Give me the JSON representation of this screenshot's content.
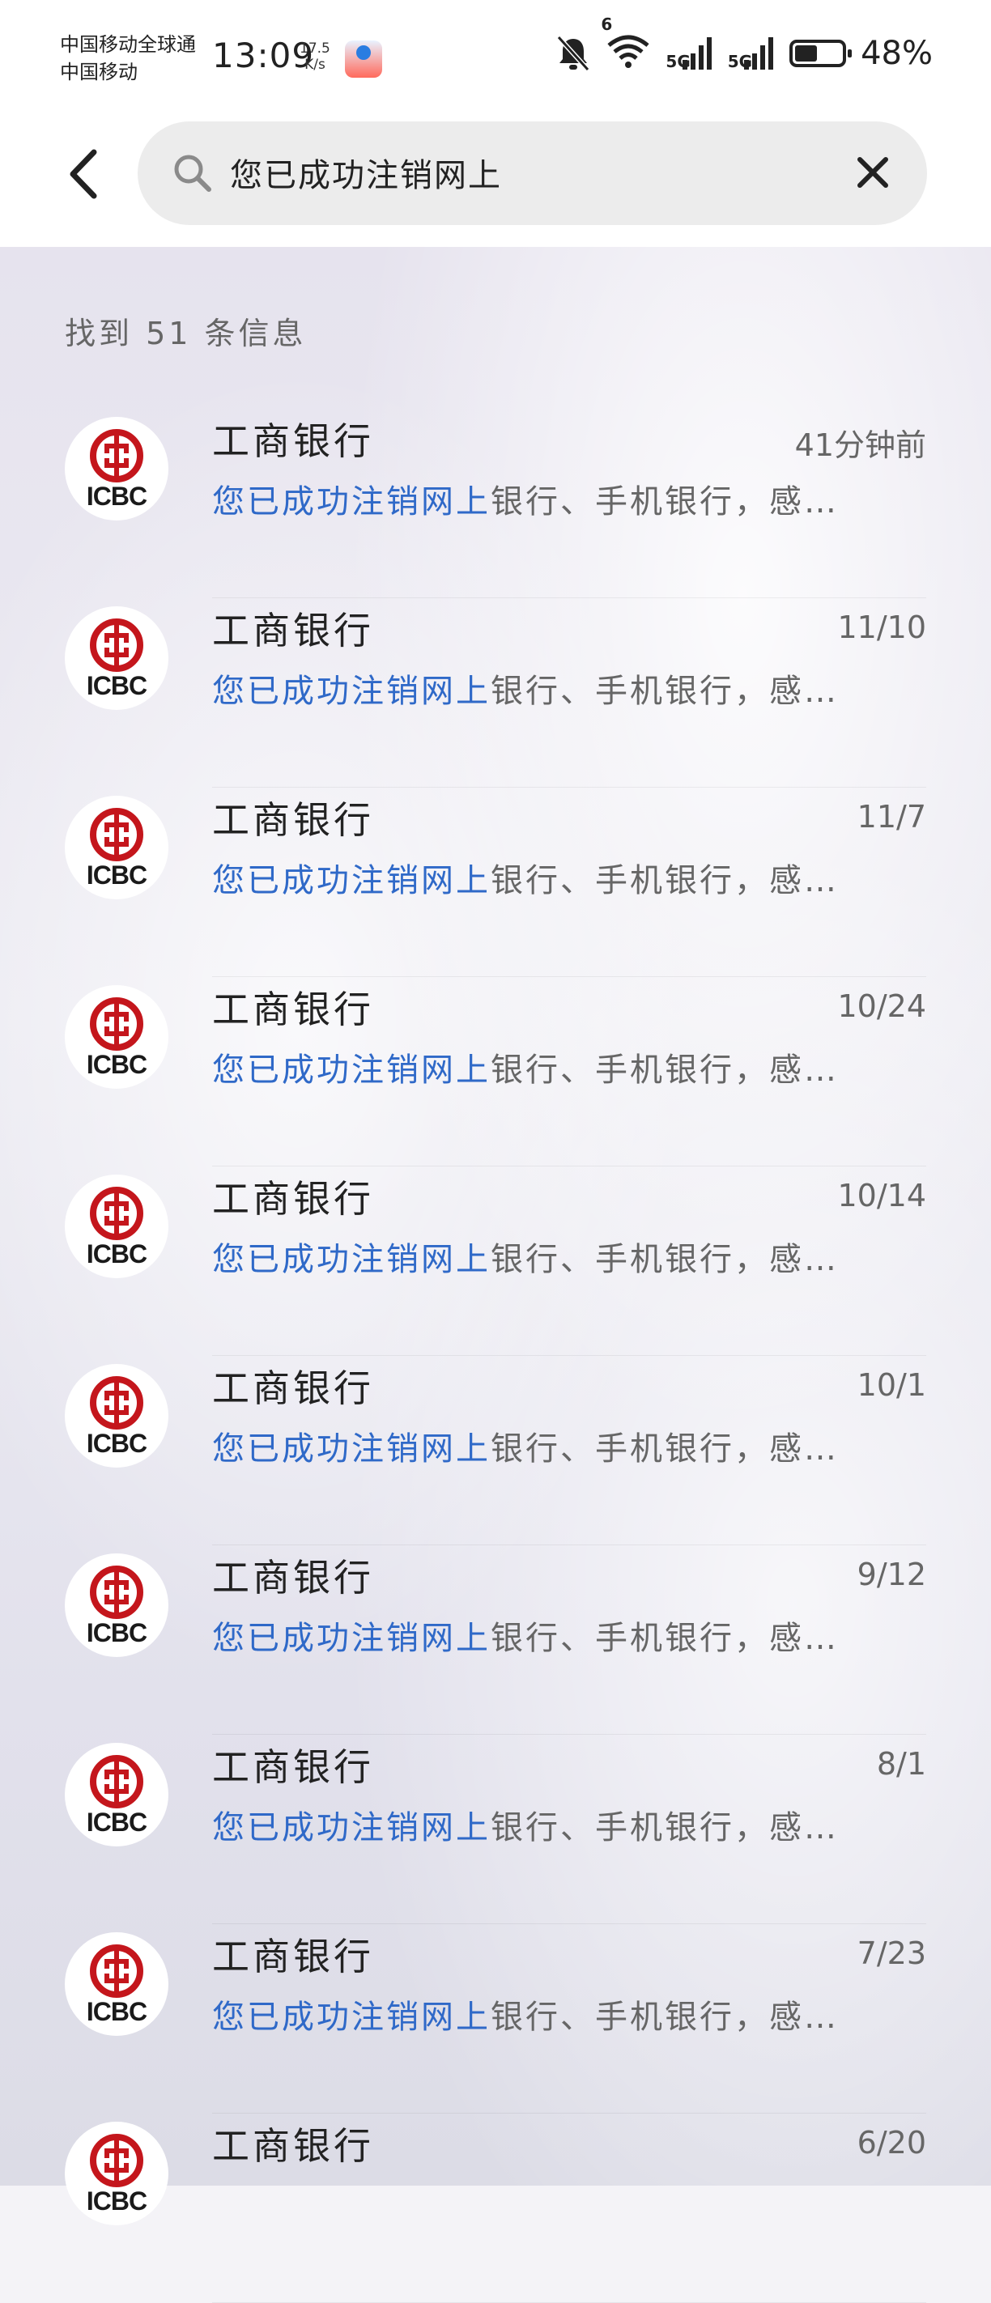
{
  "status_bar": {
    "carrier_line1": "中国移动全球通",
    "carrier_line2": "中国移动",
    "time": "13:09",
    "net_speed_value": "17.5",
    "net_speed_unit": "K/s",
    "battery_text": "48%",
    "battery_level": 0.48,
    "signal_1_label": "5G",
    "signal_2_label": "5G",
    "wifi_label": "6",
    "icons": [
      "bell-off-icon",
      "wifi-icon",
      "signal-icon",
      "signal-icon",
      "battery-icon"
    ]
  },
  "search": {
    "query": "您已成功注销网上",
    "back_icon": "chevron-left-icon",
    "search_icon": "magnifier-icon",
    "clear_icon": "close-icon"
  },
  "results": {
    "count_text": "找到 51 条信息"
  },
  "messages": [
    {
      "sender": "工商银行",
      "time": "41分钟前",
      "highlight": "您已成功注销网上",
      "rest": "银行、手机银行，感…",
      "logo_text": "ICBC"
    },
    {
      "sender": "工商银行",
      "time": "11/10",
      "highlight": "您已成功注销网上",
      "rest": "银行、手机银行，感…",
      "logo_text": "ICBC"
    },
    {
      "sender": "工商银行",
      "time": "11/7",
      "highlight": "您已成功注销网上",
      "rest": "银行、手机银行，感…",
      "logo_text": "ICBC"
    },
    {
      "sender": "工商银行",
      "time": "10/24",
      "highlight": "您已成功注销网上",
      "rest": "银行、手机银行，感…",
      "logo_text": "ICBC"
    },
    {
      "sender": "工商银行",
      "time": "10/14",
      "highlight": "您已成功注销网上",
      "rest": "银行、手机银行，感…",
      "logo_text": "ICBC"
    },
    {
      "sender": "工商银行",
      "time": "10/1",
      "highlight": "您已成功注销网上",
      "rest": "银行、手机银行，感…",
      "logo_text": "ICBC"
    },
    {
      "sender": "工商银行",
      "time": "9/12",
      "highlight": "您已成功注销网上",
      "rest": "银行、手机银行，感…",
      "logo_text": "ICBC"
    },
    {
      "sender": "工商银行",
      "time": "8/1",
      "highlight": "您已成功注销网上",
      "rest": "银行、手机银行，感…",
      "logo_text": "ICBC"
    },
    {
      "sender": "工商银行",
      "time": "7/23",
      "highlight": "您已成功注销网上",
      "rest": "银行、手机银行，感…",
      "logo_text": "ICBC"
    },
    {
      "sender": "工商银行",
      "time": "6/20",
      "highlight": "",
      "rest": "",
      "logo_text": "ICBC"
    }
  ],
  "colors": {
    "highlight": "#2f69c8",
    "icbc_red": "#c4161c",
    "text_primary": "#222222",
    "text_secondary": "#666666"
  }
}
